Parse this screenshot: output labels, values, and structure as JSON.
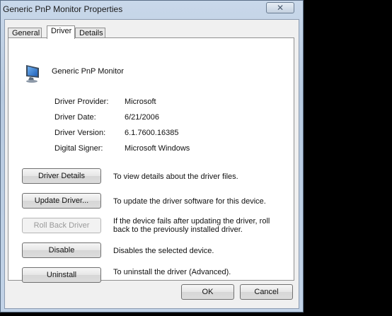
{
  "window": {
    "title": "Generic PnP Monitor Properties",
    "close_glyph": "✕"
  },
  "tabs": [
    {
      "label": "General",
      "active": false
    },
    {
      "label": "Driver",
      "active": true
    },
    {
      "label": "Details",
      "active": false
    }
  ],
  "device": {
    "name": "Generic PnP Monitor",
    "icon": "monitor-icon"
  },
  "properties": [
    {
      "label": "Driver Provider:",
      "value": "Microsoft"
    },
    {
      "label": "Driver Date:",
      "value": "6/21/2006"
    },
    {
      "label": "Driver Version:",
      "value": "6.1.7600.16385"
    },
    {
      "label": "Digital Signer:",
      "value": "Microsoft Windows"
    }
  ],
  "actions": [
    {
      "button": "Driver Details",
      "description": "To view details about the driver files.",
      "enabled": true
    },
    {
      "button": "Update Driver...",
      "description": "To update the driver software for this device.",
      "enabled": true
    },
    {
      "button": "Roll Back Driver",
      "description": "If the device fails after updating the driver, roll back to the previously installed driver.",
      "enabled": false
    },
    {
      "button": "Disable",
      "description": "Disables the selected device.",
      "enabled": true
    },
    {
      "button": "Uninstall",
      "description": "To uninstall the driver (Advanced).",
      "enabled": true
    }
  ],
  "footer": {
    "ok_label": "OK",
    "cancel_label": "Cancel"
  }
}
